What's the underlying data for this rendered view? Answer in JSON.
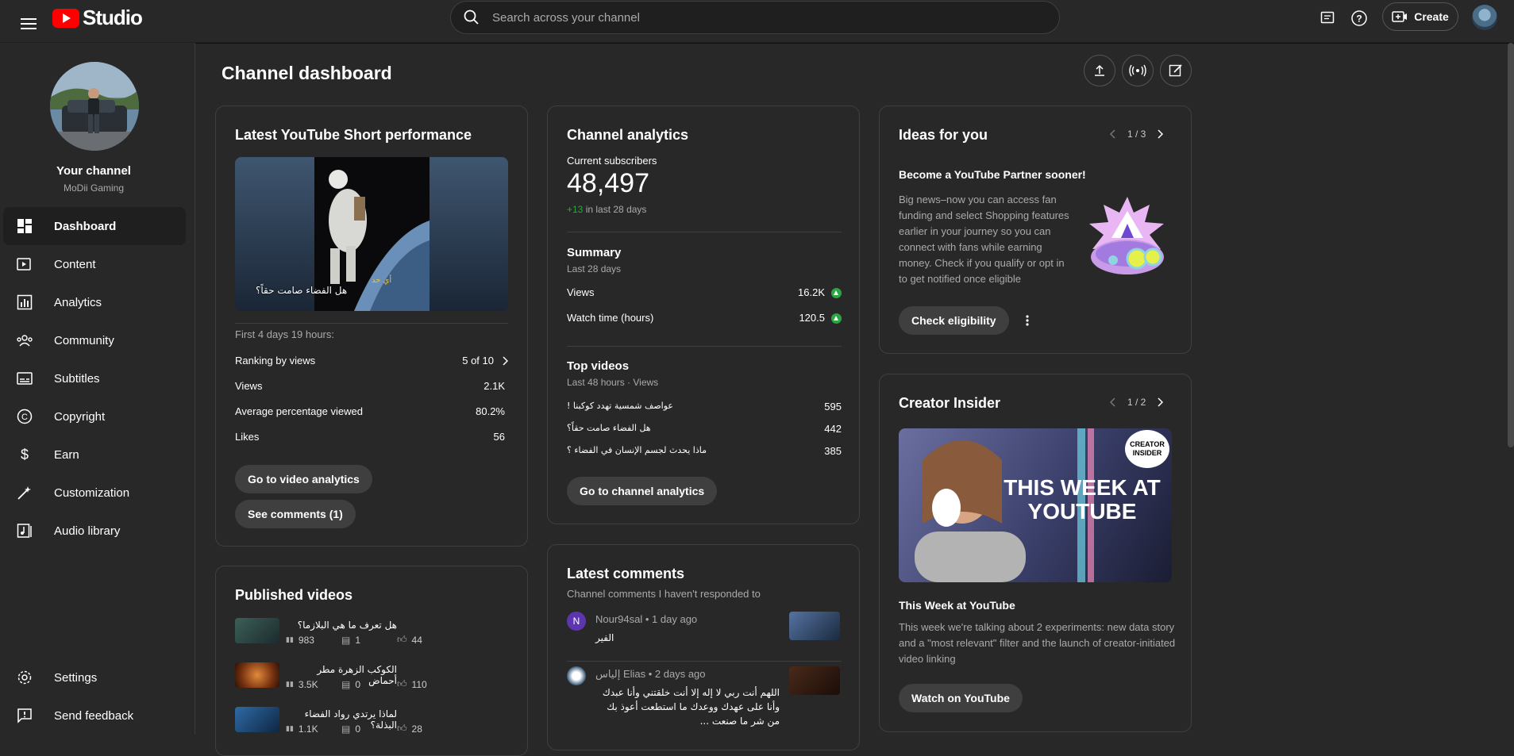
{
  "topbar": {
    "logo_text": "Studio",
    "search_placeholder": "Search across your channel",
    "create_label": "Create"
  },
  "sidebar": {
    "channel_title": "Your channel",
    "channel_name": "MoDii Gaming",
    "items": [
      {
        "label": "Dashboard",
        "icon": "dashboard-icon",
        "active": true
      },
      {
        "label": "Content",
        "icon": "content-icon"
      },
      {
        "label": "Analytics",
        "icon": "analytics-icon"
      },
      {
        "label": "Community",
        "icon": "community-icon"
      },
      {
        "label": "Subtitles",
        "icon": "subtitles-icon"
      },
      {
        "label": "Copyright",
        "icon": "copyright-icon"
      },
      {
        "label": "Earn",
        "icon": "earn-icon"
      },
      {
        "label": "Customization",
        "icon": "customization-icon"
      },
      {
        "label": "Audio library",
        "icon": "audio-library-icon"
      }
    ],
    "bottom": [
      {
        "label": "Settings",
        "icon": "gear-icon"
      },
      {
        "label": "Send feedback",
        "icon": "feedback-icon"
      }
    ]
  },
  "page": {
    "title": "Channel dashboard"
  },
  "short_card": {
    "title": "Latest YouTube Short performance",
    "thumb_caption": "هل الفضاء صامت حقاً؟",
    "thumb_caption2": "أي حد",
    "period": "First 4 days 19 hours:",
    "stats": [
      {
        "label": "Ranking by views",
        "value": "5 of 10"
      },
      {
        "label": "Views",
        "value": "2.1K"
      },
      {
        "label": "Average percentage viewed",
        "value": "80.2%"
      },
      {
        "label": "Likes",
        "value": "56"
      }
    ],
    "btn_analytics": "Go to video analytics",
    "btn_comments": "See comments (1)"
  },
  "analytics_card": {
    "title": "Channel analytics",
    "subs_label": "Current subscribers",
    "subs_value": "48,497",
    "subs_delta": "+13",
    "subs_delta_suffix": "in last 28 days",
    "summary_title": "Summary",
    "summary_period": "Last 28 days",
    "summary": [
      {
        "label": "Views",
        "value": "16.2K"
      },
      {
        "label": "Watch time (hours)",
        "value": "120.5"
      }
    ],
    "top_title": "Top videos",
    "top_period": "Last 48 hours · Views",
    "top_videos": [
      {
        "title": "عواصف شمسية تهدد كوكبنا !",
        "views": "595"
      },
      {
        "title": "هل الفضاء صامت حقاً؟",
        "views": "442"
      },
      {
        "title": "ماذا يحدث لجسم الإنسان في الفضاء ؟",
        "views": "385"
      }
    ],
    "btn": "Go to channel analytics"
  },
  "ideas_card": {
    "title": "Ideas for you",
    "pager": "1 / 3",
    "headline": "Become a YouTube Partner sooner!",
    "body": "Big news–now you can access fan funding and select Shopping features earlier in your journey so you can connect with fans while earning money. Check if you qualify or opt in to get notified once eligible",
    "btn": "Check eligibility"
  },
  "insider_card": {
    "title": "Creator Insider",
    "pager": "1 / 2",
    "badge": "CREATOR INSIDER",
    "thumb_text": "THIS WEEK AT YOUTUBE",
    "headline": "This Week at YouTube",
    "body": "This week we're talking about 2 experiments: new data story and a \"most relevant\" filter and the launch of creator-initiated video linking",
    "btn": "Watch on YouTube"
  },
  "published_card": {
    "title": "Published videos",
    "videos": [
      {
        "title": "هل تعرف ما هي البلازما؟",
        "views": "983",
        "comments": "1",
        "likes": "44"
      },
      {
        "title": "الكوكب الزهرة مطر أحماض",
        "views": "3.5K",
        "comments": "0",
        "likes": "110"
      },
      {
        "title": "لماذا يرتدي رواد الفضاء البذلة؟",
        "views": "1.1K",
        "comments": "0",
        "likes": "28"
      }
    ]
  },
  "comments_card": {
    "title": "Latest comments",
    "subtitle": "Channel comments I haven't responded to",
    "comments": [
      {
        "avatar_letter": "N",
        "author": "Nour94sal",
        "time": "1 day ago",
        "text": "الفير"
      },
      {
        "avatar_letter": "",
        "author": "إلياس Elias",
        "time": "2 days ago",
        "text": "اللهم أنت ربي لا إله إلا أنت خلقتني وأنا عبدك وأنا على عهدك ووعدك ما استطعت أعوذ بك من شر ما صنعت ..."
      }
    ]
  },
  "colors": {
    "bg": "#282828",
    "accent_red": "#ff0000",
    "green": "#2ba640"
  }
}
